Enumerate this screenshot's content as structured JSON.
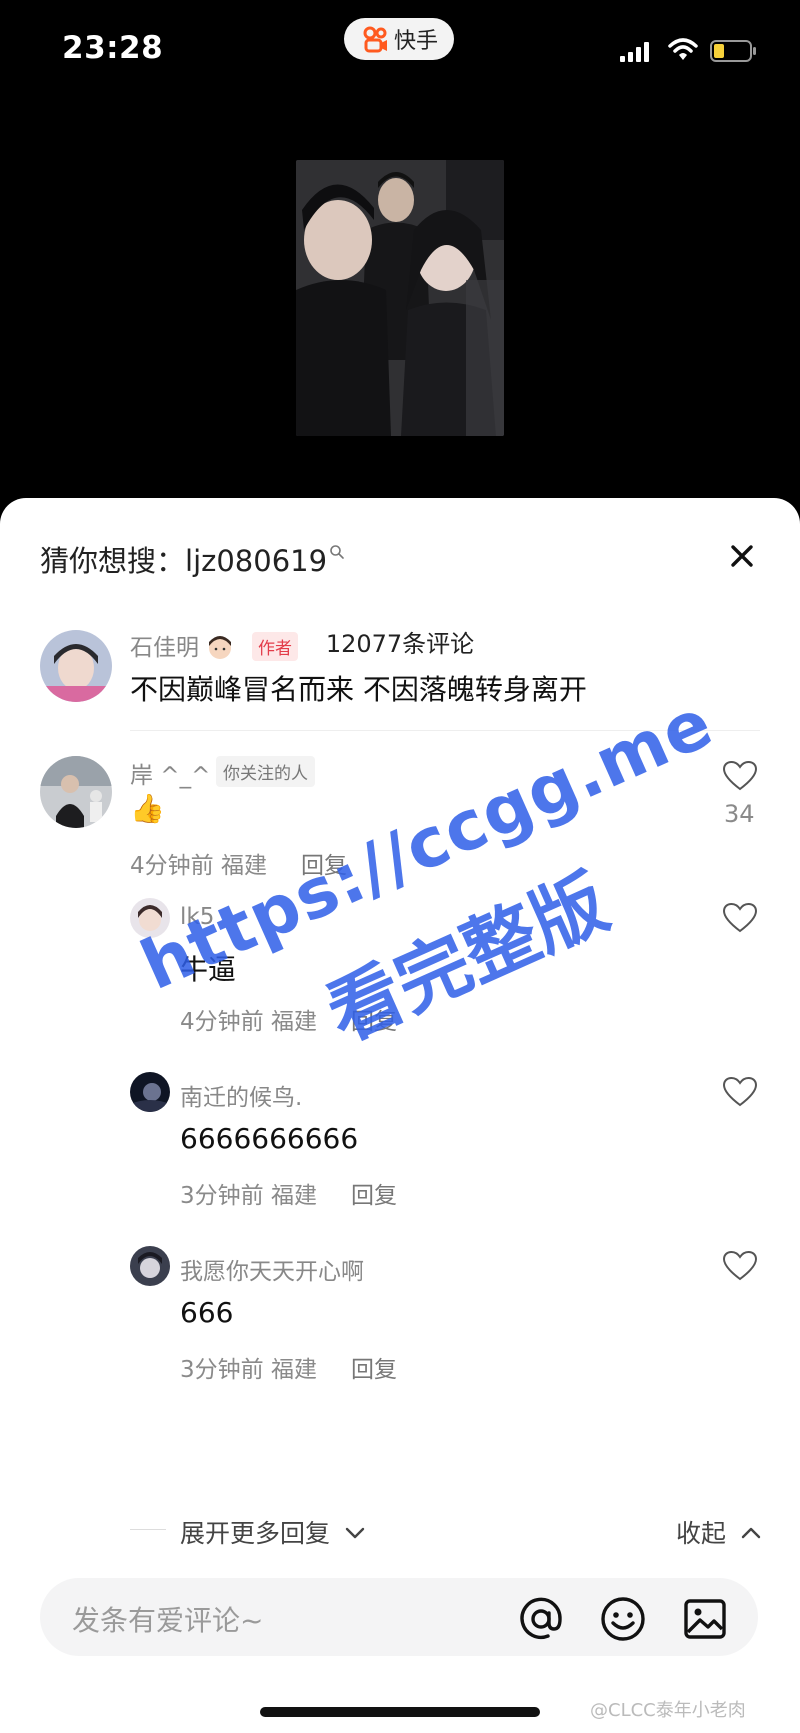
{
  "status_bar": {
    "time": "23:28",
    "app_name": "快手"
  },
  "panel": {
    "guess_prefix": "猜你想搜：",
    "guess_keyword": "ljz080619",
    "comment_count": "12077条评论"
  },
  "author_comment": {
    "user": "石佳明",
    "badge": "作者",
    "text": "不因巅峰冒名而来 不因落魄转身离开"
  },
  "comment": {
    "user": "岸 ^_^",
    "badge": "你关注的人",
    "text": "👍",
    "likes": "34",
    "meta": "4分钟前 福建",
    "reply_label": "回复"
  },
  "replies": [
    {
      "user": "lk5",
      "text": "牛逼",
      "meta": "4分钟前 福建",
      "reply_label": "回复"
    },
    {
      "user": "南迁的候鸟.",
      "text": "6666666666",
      "meta": "3分钟前 福建",
      "reply_label": "回复"
    },
    {
      "user": "我愿你天天开心啊",
      "text": "666",
      "meta": "3分钟前 福建",
      "reply_label": "回复"
    }
  ],
  "expand_label": "展开更多回复",
  "collapse_label": "收起",
  "input": {
    "placeholder": "发条有爱评论~"
  },
  "watermark": {
    "line1": "https://ccgg.me",
    "line2": "看完整版"
  },
  "credit": "@CLCC泰年小老肉",
  "colors": {
    "author_badge": "#e33d4a",
    "watermark": "#2f5fe8"
  },
  "icons": [
    "kuaishou-logo-icon",
    "signal-icon",
    "wifi-icon",
    "battery-icon",
    "close-icon",
    "heart-icon",
    "chevron-down-icon",
    "chevron-up-icon",
    "at-icon",
    "emoji-icon",
    "image-icon"
  ]
}
